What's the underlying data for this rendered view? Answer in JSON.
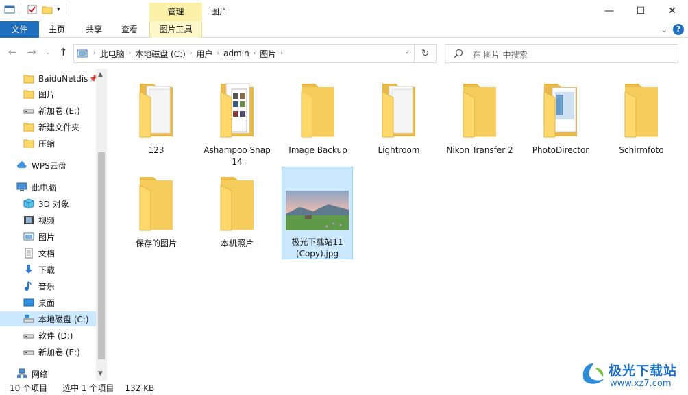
{
  "window": {
    "title": "图片",
    "context_tab": "管理",
    "minimize": "—",
    "maximize": "☐",
    "close": "✕"
  },
  "ribbon": {
    "tabs": [
      "文件",
      "主页",
      "共享",
      "查看",
      "图片工具"
    ],
    "expand_icon": "chevron-down-icon",
    "help": "?"
  },
  "address": {
    "crumbs": [
      "此电脑",
      "本地磁盘 (C:)",
      "用户",
      "admin",
      "图片"
    ]
  },
  "search": {
    "placeholder": "在 图片 中搜索"
  },
  "sidebar": {
    "items": [
      {
        "label": "BaiduNetdis",
        "icon": "folder-icon",
        "pinned": true
      },
      {
        "label": "图片",
        "icon": "folder-icon"
      },
      {
        "label": "新加卷 (E:)",
        "icon": "drive-icon"
      },
      {
        "label": "新建文件夹",
        "icon": "folder-icon"
      },
      {
        "label": "压缩",
        "icon": "folder-icon"
      },
      {
        "label": "WPS云盘",
        "icon": "cloud-icon"
      },
      {
        "label": "此电脑",
        "icon": "computer-icon"
      },
      {
        "label": "3D 对象",
        "icon": "cube-icon"
      },
      {
        "label": "视频",
        "icon": "video-icon"
      },
      {
        "label": "图片",
        "icon": "picture-icon"
      },
      {
        "label": "文档",
        "icon": "document-icon"
      },
      {
        "label": "下载",
        "icon": "download-icon"
      },
      {
        "label": "音乐",
        "icon": "music-icon"
      },
      {
        "label": "桌面",
        "icon": "desktop-icon"
      },
      {
        "label": "本地磁盘 (C:)",
        "icon": "system-drive-icon",
        "selected": true
      },
      {
        "label": "软件 (D:)",
        "icon": "drive-icon"
      },
      {
        "label": "新加卷 (E:)",
        "icon": "drive-icon"
      },
      {
        "label": "网络",
        "icon": "network-icon"
      }
    ]
  },
  "files": [
    {
      "label": "123",
      "type": "folder-with-docs"
    },
    {
      "label": "Ashampoo Snap 14",
      "type": "folder-with-screens"
    },
    {
      "label": "Image Backup",
      "type": "folder"
    },
    {
      "label": "Lightroom",
      "type": "folder-with-docs"
    },
    {
      "label": "Nikon Transfer 2",
      "type": "folder"
    },
    {
      "label": "PhotoDirector",
      "type": "folder-with-photo"
    },
    {
      "label": "Schirmfoto",
      "type": "folder"
    },
    {
      "label": "保存的图片",
      "type": "folder"
    },
    {
      "label": "本机照片",
      "type": "folder"
    },
    {
      "label": "极光下载站11 (Copy).jpg",
      "type": "image",
      "selected": true
    }
  ],
  "status": {
    "count": "10 个项目",
    "selection": "选中 1 个项目",
    "size": "132 KB"
  },
  "watermark": {
    "brand": "极光下载站",
    "url": "www.xz7.com"
  }
}
